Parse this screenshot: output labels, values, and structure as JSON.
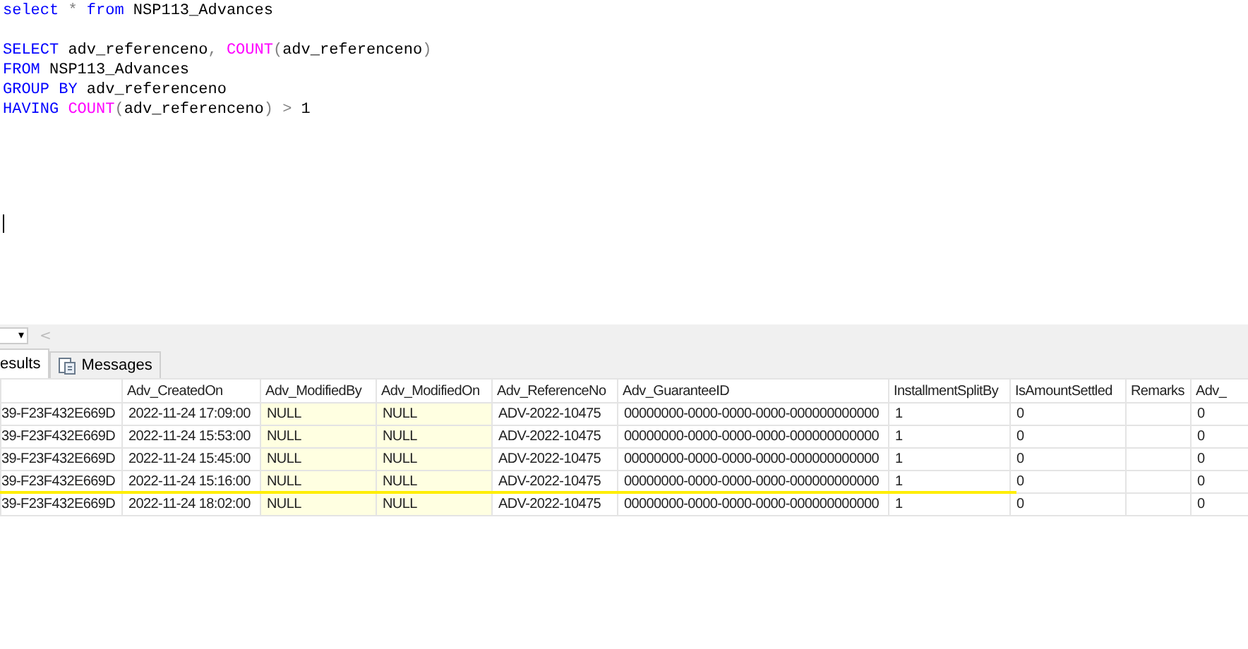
{
  "editor": {
    "lines": [
      {
        "gap_before": false,
        "tokens": [
          {
            "kind": "keyword",
            "text": "select"
          },
          {
            "kind": "operator",
            "text": " * "
          },
          {
            "kind": "keyword",
            "text": "from"
          },
          {
            "kind": "text",
            "text": " NSP113_Advances"
          }
        ]
      },
      {
        "gap_before": true,
        "tokens": [
          {
            "kind": "keyword",
            "text": "SELECT"
          },
          {
            "kind": "text",
            "text": " adv_referenceno"
          },
          {
            "kind": "operator",
            "text": ","
          },
          {
            "kind": "function",
            "text": " COUNT"
          },
          {
            "kind": "operator",
            "text": "("
          },
          {
            "kind": "text",
            "text": "adv_referenceno"
          },
          {
            "kind": "operator",
            "text": ")"
          }
        ]
      },
      {
        "gap_before": false,
        "tokens": [
          {
            "kind": "keyword",
            "text": "FROM"
          },
          {
            "kind": "text",
            "text": " NSP113_Advances"
          }
        ]
      },
      {
        "gap_before": false,
        "tokens": [
          {
            "kind": "keyword",
            "text": "GROUP BY"
          },
          {
            "kind": "text",
            "text": " adv_referenceno"
          }
        ]
      },
      {
        "gap_before": false,
        "tokens": [
          {
            "kind": "keyword",
            "text": "HAVING"
          },
          {
            "kind": "function",
            "text": " COUNT"
          },
          {
            "kind": "operator",
            "text": "("
          },
          {
            "kind": "text",
            "text": "adv_referenceno"
          },
          {
            "kind": "operator",
            "text": ")"
          },
          {
            "kind": "operator",
            "text": " > "
          },
          {
            "kind": "text",
            "text": "1"
          }
        ]
      }
    ]
  },
  "toolbar": {
    "dropdown_arrow": "▾",
    "scroll_left": "<"
  },
  "tabs": [
    {
      "label": "esults",
      "selected": true
    },
    {
      "label": "Messages",
      "selected": false
    }
  ],
  "table": {
    "columns": [
      null,
      "Adv_CreatedOn",
      "Adv_ModifiedBy",
      "Adv_ModifiedOn",
      "Adv_ReferenceNo",
      "Adv_GuaranteeID",
      "InstallmentSplitBy",
      "IsAmountSettled",
      "Remarks",
      "Adv_"
    ],
    "rows": [
      [
        "39-F23F432E669D",
        "2022-11-24 17:09:00",
        "NULL",
        "NULL",
        "ADV-2022-10475",
        "00000000-0000-0000-0000-000000000000",
        "1",
        "0",
        null,
        "0"
      ],
      [
        "39-F23F432E669D",
        "2022-11-24 15:53:00",
        "NULL",
        "NULL",
        "ADV-2022-10475",
        "00000000-0000-0000-0000-000000000000",
        "1",
        "0",
        null,
        "0"
      ],
      [
        "39-F23F432E669D",
        "2022-11-24 15:45:00",
        "NULL",
        "NULL",
        "ADV-2022-10475",
        "00000000-0000-0000-0000-000000000000",
        "1",
        "0",
        null,
        "0"
      ],
      [
        "39-F23F432E669D",
        "2022-11-24 15:16:00",
        "NULL",
        "NULL",
        "ADV-2022-10475",
        "00000000-0000-0000-0000-000000000000",
        "1",
        "0",
        null,
        "0"
      ],
      [
        "39-F23F432E669D",
        "2022-11-24 18:02:00",
        "NULL",
        "NULL",
        "ADV-2022-10475",
        "00000000-0000-0000-0000-000000000000",
        "1",
        "0",
        null,
        "0"
      ]
    ]
  }
}
